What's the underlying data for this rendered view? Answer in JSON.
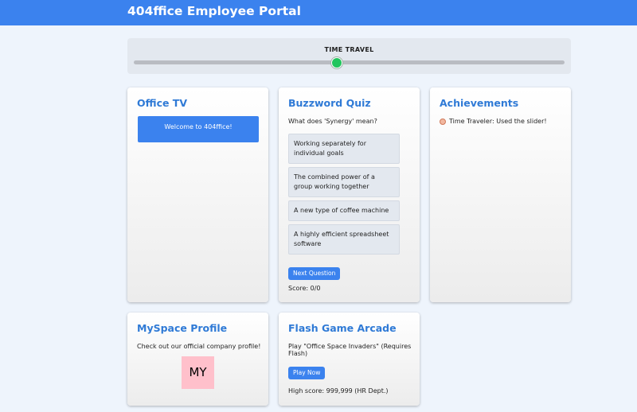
{
  "header": {
    "title": "404ffice Employee Portal"
  },
  "time_travel": {
    "label": "TIME TRAVEL",
    "slider_value_fraction": 0.47
  },
  "office_tv": {
    "title": "Office TV",
    "screen_text": "Welcome to 404ffice!"
  },
  "quiz": {
    "title": "Buzzword Quiz",
    "question": "What does 'Synergy' mean?",
    "options": [
      "Working separately for individual goals",
      "The combined power of a group working together",
      "A new type of coffee machine",
      "A highly efficient spreadsheet software"
    ],
    "next_label": "Next Question",
    "score_text": "Score: 0/0"
  },
  "achievements": {
    "title": "Achievements",
    "items": [
      {
        "icon": "medal-icon",
        "text": "Time Traveler: Used the slider!"
      }
    ]
  },
  "myspace": {
    "title": "MySpace Profile",
    "description": "Check out our official company profile!",
    "logo_text": "MY"
  },
  "arcade": {
    "title": "Flash Game Arcade",
    "description": "Play \"Office Space Invaders\" (Requires Flash)",
    "play_label": "Play Now",
    "high_score": "High score: 999,999 (HR Dept.)"
  },
  "colors": {
    "header": "#3b82ee",
    "title_accent": "#2f7ad6",
    "slider_thumb": "#22c55e",
    "myspace_logo_bg": "#ffc0cb"
  }
}
